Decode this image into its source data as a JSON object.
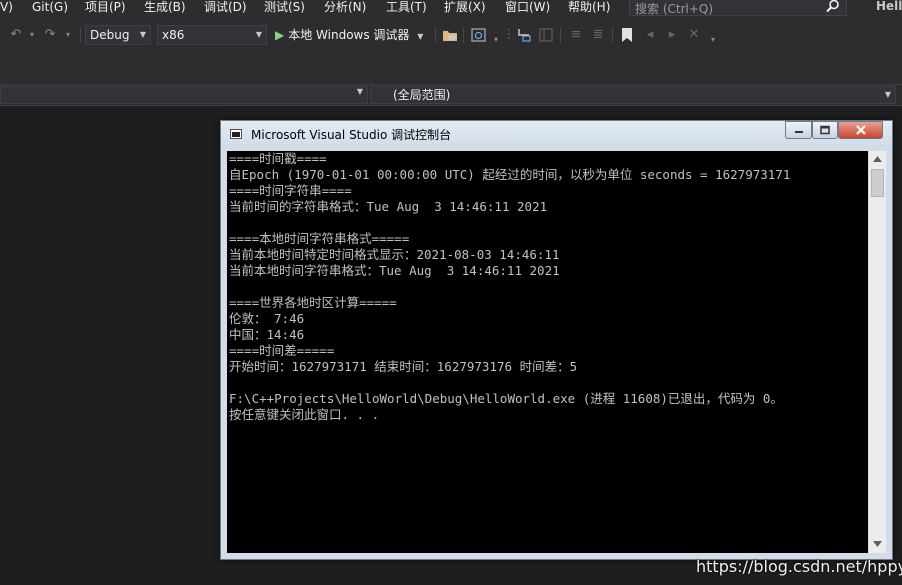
{
  "menu": {
    "items": [
      "V)",
      "Git(G)",
      "项目(P)",
      "生成(B)",
      "调试(D)",
      "测试(S)",
      "分析(N)",
      "工具(T)",
      "扩展(X)",
      "窗口(W)",
      "帮助(H)"
    ],
    "search_placeholder": "搜索 (Ctrl+Q)",
    "solution_name_partial": "Hell"
  },
  "toolbar": {
    "config": "Debug",
    "platform": "x86",
    "run_label": "本地 Windows 调试器"
  },
  "navbar": {
    "scope": "(全局范围)"
  },
  "console": {
    "title": "Microsoft Visual Studio 调试控制台",
    "lines": [
      "====时间戳====",
      "自Epoch (1970-01-01 00:00:00 UTC) 起经过的时间，以秒为单位 seconds = 1627973171",
      "====时间字符串====",
      "当前时间的字符串格式：Tue Aug  3 14:46:11 2021",
      "",
      "====本地时间字符串格式=====",
      "当前本地时间特定时间格式显示：2021-08-03 14:46:11",
      "当前本地时间字符串格式：Tue Aug  3 14:46:11 2021",
      "",
      "====世界各地时区计算=====",
      "伦敦： 7:46",
      "中国：14:46",
      "====时间差=====",
      "开始时间：1627973171 结束时间：1627973176 时间差：5",
      "",
      "F:\\C++Projects\\HelloWorld\\Debug\\HelloWorld.exe (进程 11608)已退出，代码为 0。",
      "按任意键关闭此窗口. . ."
    ]
  },
  "watermark": "https://blog.csdn.net/hppyW",
  "colors": {
    "ide_background": "#1e1e1e",
    "chrome": "#2d2d30",
    "run_green": "#89d185",
    "console_bg": "#000000",
    "console_text": "#c0c0c0",
    "close_red": "#c8452f"
  }
}
